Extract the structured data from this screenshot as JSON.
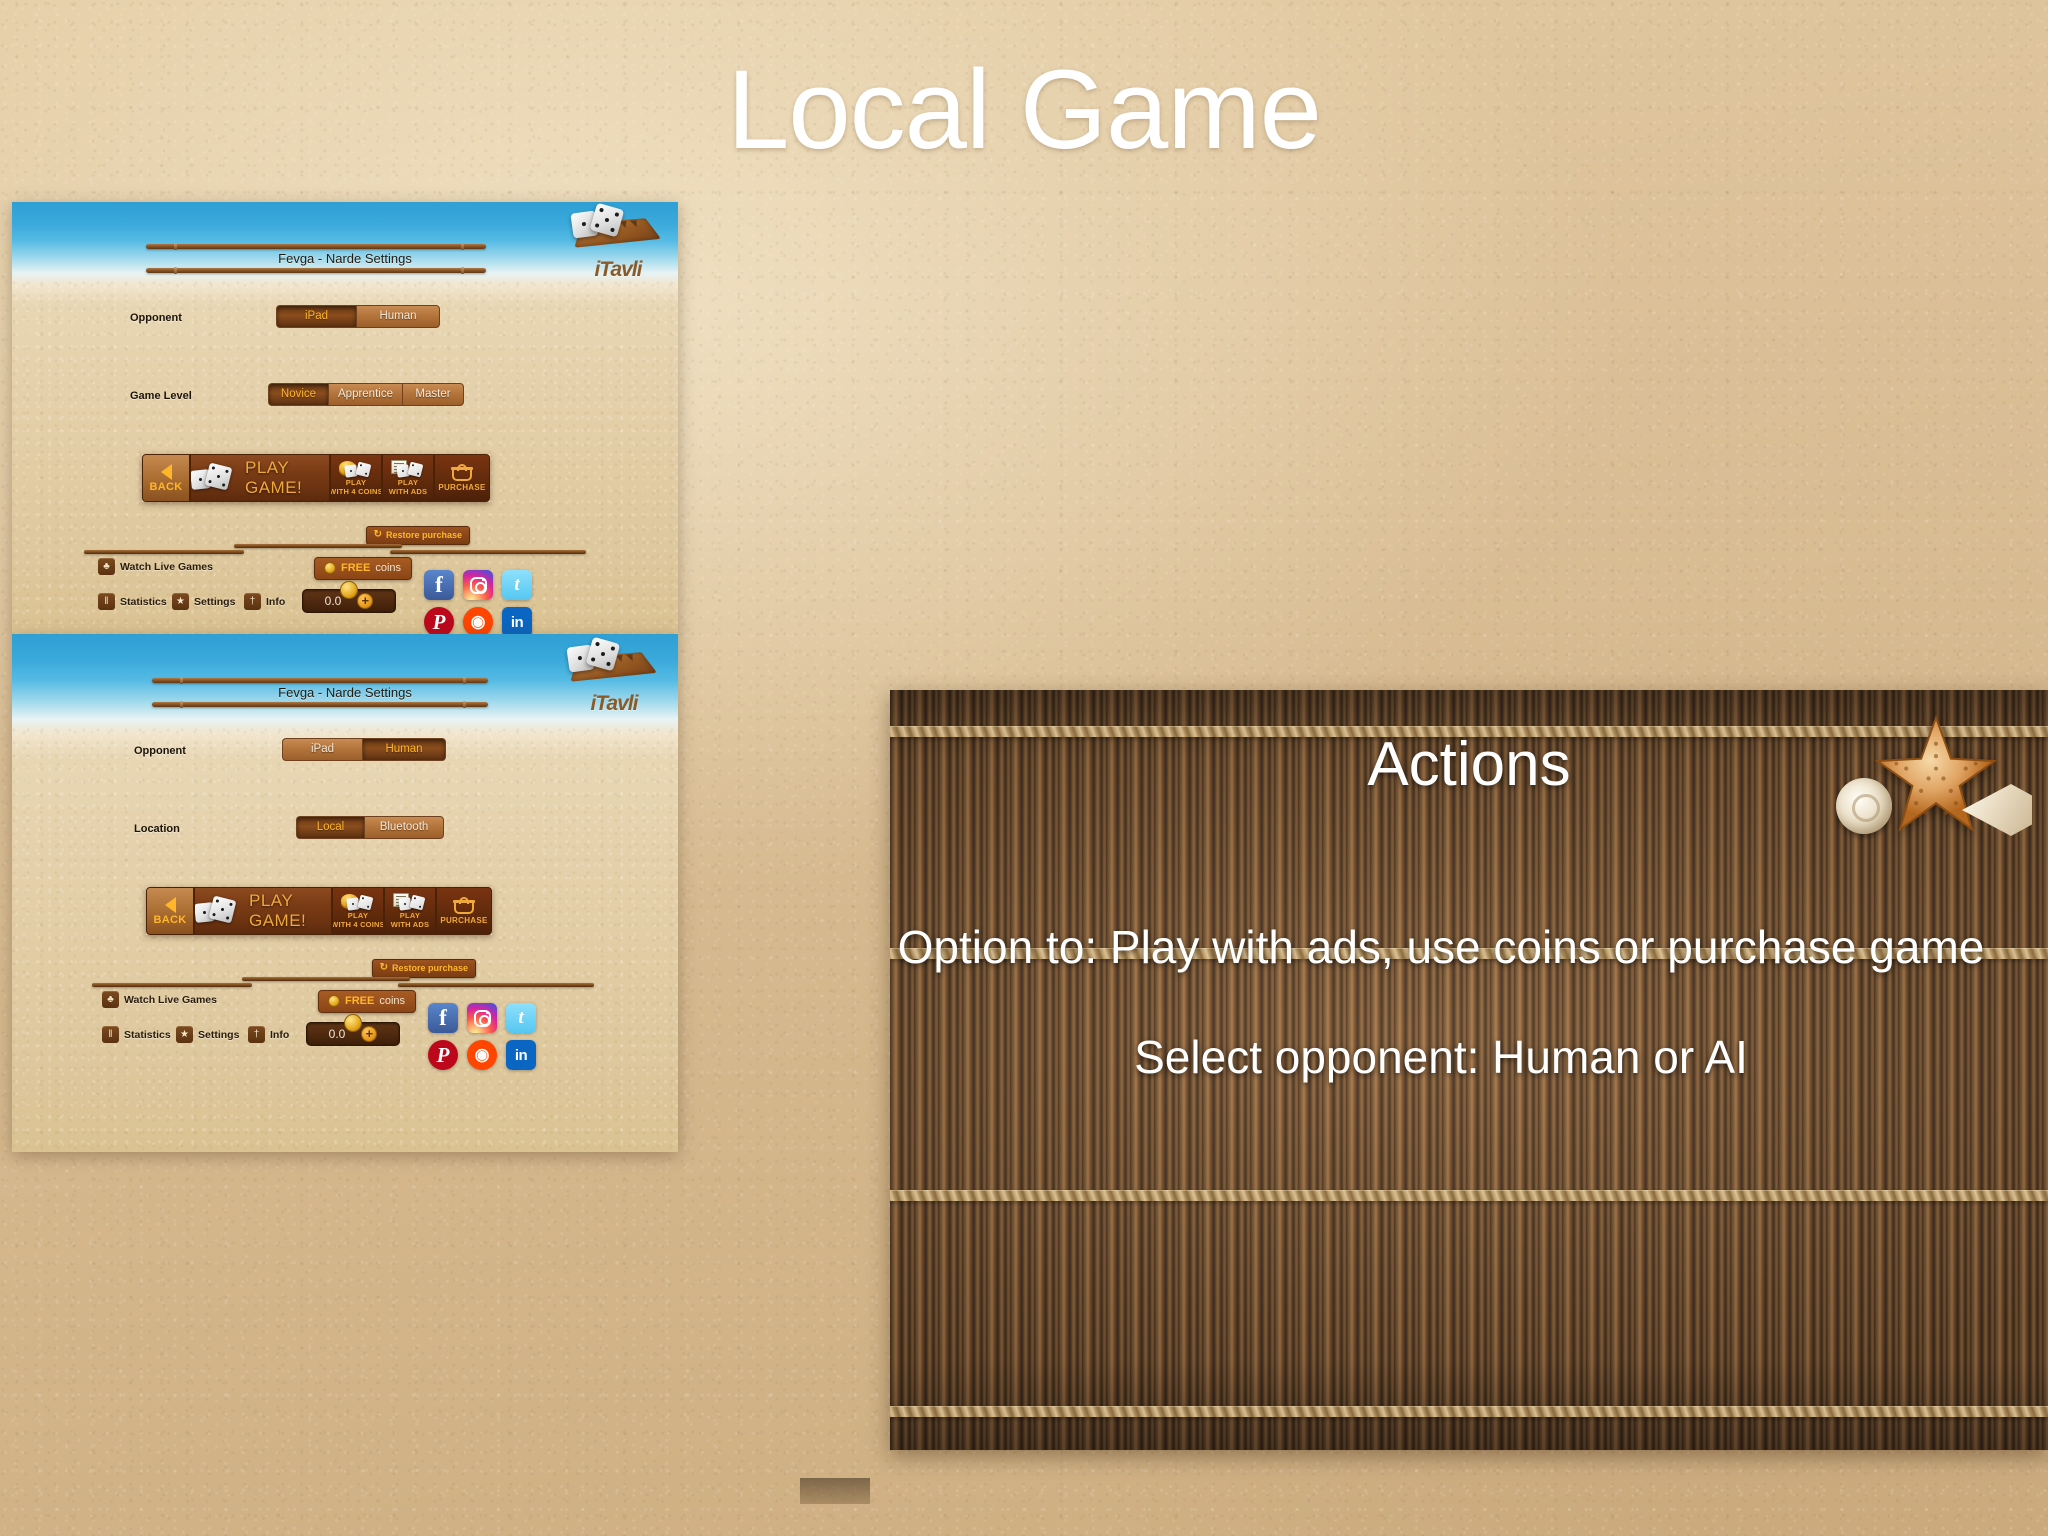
{
  "slide": {
    "title": "Local Game"
  },
  "app": {
    "title": "Fevga - Narde Settings",
    "logo_word": "iTavli"
  },
  "screens": [
    {
      "id": "screen-ai",
      "rows": [
        {
          "label": "Opponent",
          "options": [
            "iPad",
            "Human"
          ],
          "selected": 0
        },
        {
          "label": "Game Level",
          "options": [
            "Novice",
            "Apprentice",
            "Master"
          ],
          "selected": 0
        }
      ],
      "actions": {
        "back_label": "BACK",
        "play_label": "PLAY GAME!",
        "coins_line1": "PLAY",
        "coins_line2": "WITH 4 COINS",
        "ads_line1": "PLAY",
        "ads_line2": "WITH ADS",
        "purchase_label": "PURCHASE"
      },
      "restore_label": "Restore purchase",
      "restore_icon": "restore-icon",
      "tools": {
        "watch_live": "Watch Live Games",
        "statistics": "Statistics",
        "settings": "Settings",
        "info": "Info"
      },
      "free_coins": {
        "word1": "FREE",
        "word2": "coins"
      },
      "coin_counter": {
        "value": "0.0",
        "plus": "+"
      },
      "social": [
        "Facebook",
        "Instagram",
        "Twitter",
        "Pinterest",
        "Reddit",
        "LinkedIn"
      ]
    },
    {
      "id": "screen-human",
      "rows": [
        {
          "label": "Opponent",
          "options": [
            "iPad",
            "Human"
          ],
          "selected": 1
        },
        {
          "label": "Location",
          "options": [
            "Local",
            "Bluetooth"
          ],
          "selected": 0
        }
      ],
      "actions": {
        "back_label": "BACK",
        "play_label": "PLAY GAME!",
        "coins_line1": "PLAY",
        "coins_line2": "WITH 4 COINS",
        "ads_line1": "PLAY",
        "ads_line2": "WITH ADS",
        "purchase_label": "PURCHASE"
      },
      "restore_label": "Restore purchase",
      "restore_icon": "restore-icon",
      "tools": {
        "watch_live": "Watch Live Games",
        "statistics": "Statistics",
        "settings": "Settings",
        "info": "Info"
      },
      "free_coins": {
        "word1": "FREE",
        "word2": "coins"
      },
      "coin_counter": {
        "value": "0.0",
        "plus": "+"
      },
      "social": [
        "Facebook",
        "Instagram",
        "Twitter",
        "Pinterest",
        "Reddit",
        "LinkedIn"
      ]
    }
  ],
  "panel": {
    "heading": "Actions",
    "paragraph1": "Option to: Play with ads, use coins or purchase game",
    "paragraph2": "Select opponent: Human or AI"
  },
  "glyphs": {
    "restore": "↻",
    "facebook": "f",
    "twitter": "t",
    "pinterest": "P",
    "reddit": "◉",
    "linkedin": "in",
    "watch_icon": "♣",
    "stats_icon": "‖",
    "settings_icon": "★",
    "info_icon": "†"
  },
  "colors": {
    "accent_orange": "#ffb629",
    "play_text": "#f0a93c",
    "wood_dark": "#5f2a0c",
    "wood_light": "#b4753c",
    "title_white": "#ffffff"
  }
}
